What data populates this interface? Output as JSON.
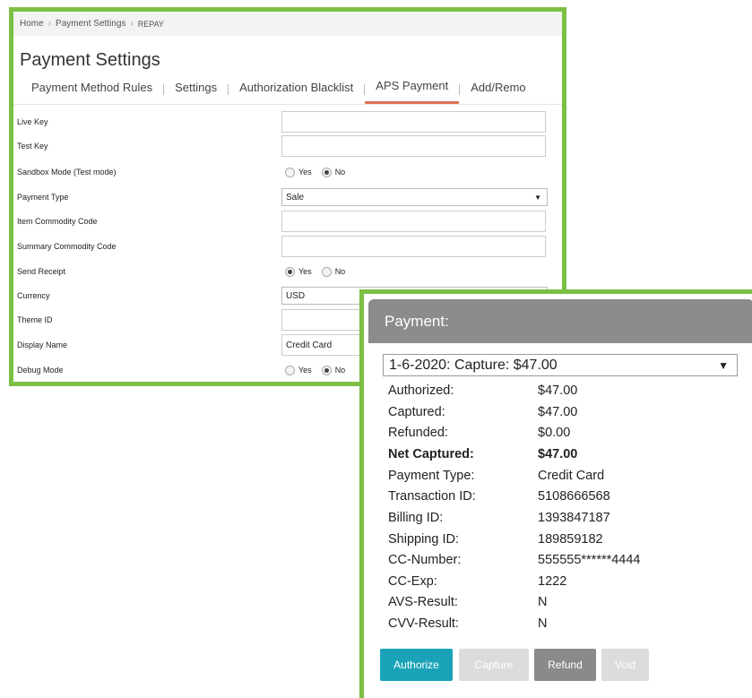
{
  "breadcrumb": {
    "home": "Home",
    "settings": "Payment Settings",
    "current": "REPAY",
    "separator": "›"
  },
  "page_title": "Payment Settings",
  "tabs": [
    {
      "label": "Payment Method Rules",
      "active": false
    },
    {
      "label": "Settings",
      "active": false
    },
    {
      "label": "Authorization Blacklist",
      "active": false
    },
    {
      "label": "APS Payment",
      "active": true
    },
    {
      "label": "Add/Remo",
      "active": false
    }
  ],
  "form": {
    "live_key": {
      "label": "Live Key",
      "value": ""
    },
    "test_key": {
      "label": "Test Key",
      "value": ""
    },
    "sandbox_mode": {
      "label": "Sandbox Mode (Test mode)",
      "yes": "Yes",
      "no": "No",
      "selected": "No"
    },
    "payment_type": {
      "label": "Payment Type",
      "value": "Sale"
    },
    "item_commodity_code": {
      "label": "Item Commodity Code",
      "value": ""
    },
    "summary_commodity_code": {
      "label": "Summary Commodity Code",
      "value": ""
    },
    "send_receipt": {
      "label": "Send Receipt",
      "yes": "Yes",
      "no": "No",
      "selected": "Yes"
    },
    "currency": {
      "label": "Currency",
      "value": "USD"
    },
    "theme_id": {
      "label": "Theme ID",
      "value": ""
    },
    "display_name": {
      "label": "Display Name",
      "value": "Credit Card"
    },
    "debug_mode": {
      "label": "Debug Mode",
      "yes": "Yes",
      "no": "No",
      "selected": "No"
    }
  },
  "payment": {
    "title": "Payment:",
    "transaction_select": "1-6-2020: Capture: $47.00",
    "details": [
      {
        "label": "Authorized:",
        "value": "$47.00"
      },
      {
        "label": "Captured:",
        "value": "$47.00"
      },
      {
        "label": "Refunded:",
        "value": "$0.00"
      },
      {
        "label": "Net Captured:",
        "value": "$47.00"
      },
      {
        "label": "Payment Type:",
        "value": "Credit Card"
      },
      {
        "label": "Transaction ID:",
        "value": "5108666568"
      },
      {
        "label": "Billing ID:",
        "value": "1393847187"
      },
      {
        "label": "Shipping ID:",
        "value": "189859182"
      },
      {
        "label": "CC-Number:",
        "value": "555555******4444"
      },
      {
        "label": "CC-Exp:",
        "value": "1222"
      },
      {
        "label": "AVS-Result:",
        "value": "N"
      },
      {
        "label": "CVV-Result:",
        "value": "N"
      }
    ],
    "buttons": {
      "authorize": {
        "label": "Authorize",
        "color": "#1aa3b8"
      },
      "capture": {
        "label": "Capture",
        "color": "#dcdcdc"
      },
      "refund": {
        "label": "Refund",
        "color": "#8a8a8a"
      },
      "void": {
        "label": "Void",
        "color": "#dcdcdc"
      }
    }
  },
  "colors": {
    "frame_green": "#7bc043",
    "active_tab_underline": "#e0705a"
  }
}
